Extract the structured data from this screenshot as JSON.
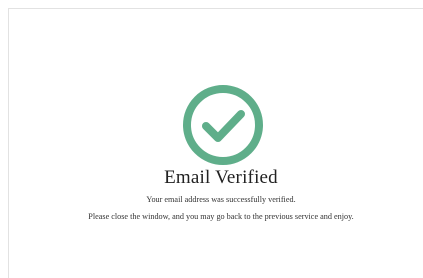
{
  "verification": {
    "title": "Email Verified",
    "message_line1": "Your email address was successfully verified.",
    "message_line2": "Please close the window, and you may go back to the previous service and enjoy.",
    "icon": "check-circle-icon",
    "accent_color": "#5fae8a"
  }
}
